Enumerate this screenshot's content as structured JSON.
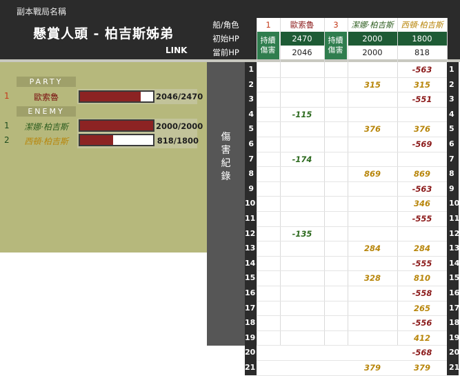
{
  "header": {
    "subtitle": "副本戰局名稱",
    "title": "懸賞人頭 - 柏吉斯姊弟",
    "link": "LINK"
  },
  "labels": {
    "ship_role": "船/角色",
    "initial_hp": "初始HP",
    "current_hp": "當前HP",
    "damage_log": "傷\n害\n紀\n錄",
    "persist_damage": "持續\n傷害"
  },
  "party": {
    "label": "PARTY",
    "members": [
      {
        "slot": "1",
        "name": "歐索魯",
        "hp": "2046/2470",
        "hp_fraction": 0.828,
        "color": "#c43a1a",
        "name_color": "#7a1010"
      }
    ]
  },
  "enemy": {
    "label": "ENEMY",
    "members": [
      {
        "slot": "1",
        "name": "潔娜·柏吉斯",
        "hp": "2000/2000",
        "hp_fraction": 1.0,
        "slot_color": "#1f4d1f",
        "name_color": "#2d5d1f"
      },
      {
        "slot": "2",
        "name": "西頓·柏吉斯",
        "hp": "818/1800",
        "hp_fraction": 0.454,
        "slot_color": "#1f4d1f",
        "name_color": "#b8860b"
      }
    ]
  },
  "columns": [
    {
      "ship": "1",
      "name": "歐索魯",
      "initial_hp": "2470",
      "current_hp": "2046",
      "name_color": "#8b1a1a",
      "ship_color": "#c43a1a"
    },
    {
      "ship": "3",
      "name": "潔娜·柏吉斯",
      "initial_hp": "2000",
      "current_hp": "2000",
      "name_color": "#2d5d1f",
      "ship_color": "#c43a1a"
    },
    {
      "ship": "",
      "name": "西頓·柏吉斯",
      "initial_hp": "1800",
      "current_hp": "818",
      "name_color": "#b8860b",
      "ship_color": "#c43a1a"
    }
  ],
  "rows": [
    {
      "n": "1",
      "c1": "",
      "c3": "",
      "c5": "-563"
    },
    {
      "n": "2",
      "c1": "",
      "c3": "315",
      "c5": "315"
    },
    {
      "n": "3",
      "c1": "",
      "c3": "",
      "c5": "-551"
    },
    {
      "n": "4",
      "c1": "-115",
      "c3": "",
      "c5": ""
    },
    {
      "n": "5",
      "c1": "",
      "c3": "376",
      "c5": "376"
    },
    {
      "n": "6",
      "c1": "",
      "c3": "",
      "c5": "-569"
    },
    {
      "n": "7",
      "c1": "-174",
      "c3": "",
      "c5": ""
    },
    {
      "n": "8",
      "c1": "",
      "c3": "869",
      "c5": "869"
    },
    {
      "n": "9",
      "c1": "",
      "c3": "",
      "c5": "-563"
    },
    {
      "n": "10",
      "c1": "",
      "c3": "",
      "c5": "346"
    },
    {
      "n": "11",
      "c1": "",
      "c3": "",
      "c5": "-555"
    },
    {
      "n": "12",
      "c1": "-135",
      "c3": "",
      "c5": ""
    },
    {
      "n": "13",
      "c1": "",
      "c3": "284",
      "c5": "284"
    },
    {
      "n": "14",
      "c1": "",
      "c3": "",
      "c5": "-555"
    },
    {
      "n": "15",
      "c1": "",
      "c3": "328",
      "c5": "810"
    },
    {
      "n": "16",
      "c1": "",
      "c3": "",
      "c5": "-558"
    },
    {
      "n": "17",
      "c1": "",
      "c3": "",
      "c5": "265"
    },
    {
      "n": "18",
      "c1": "",
      "c3": "",
      "c5": "-556"
    },
    {
      "n": "19",
      "c1": "",
      "c3": "",
      "c5": "412"
    },
    {
      "n": "20",
      "c1": "",
      "c3": "",
      "c5": "-568"
    },
    {
      "n": "21",
      "c1": "",
      "c3": "379",
      "c5": "379"
    }
  ],
  "colors": {
    "negative": "#8b1a1a",
    "positive": "#b8860b",
    "party_damage": "#2d6a1f"
  }
}
